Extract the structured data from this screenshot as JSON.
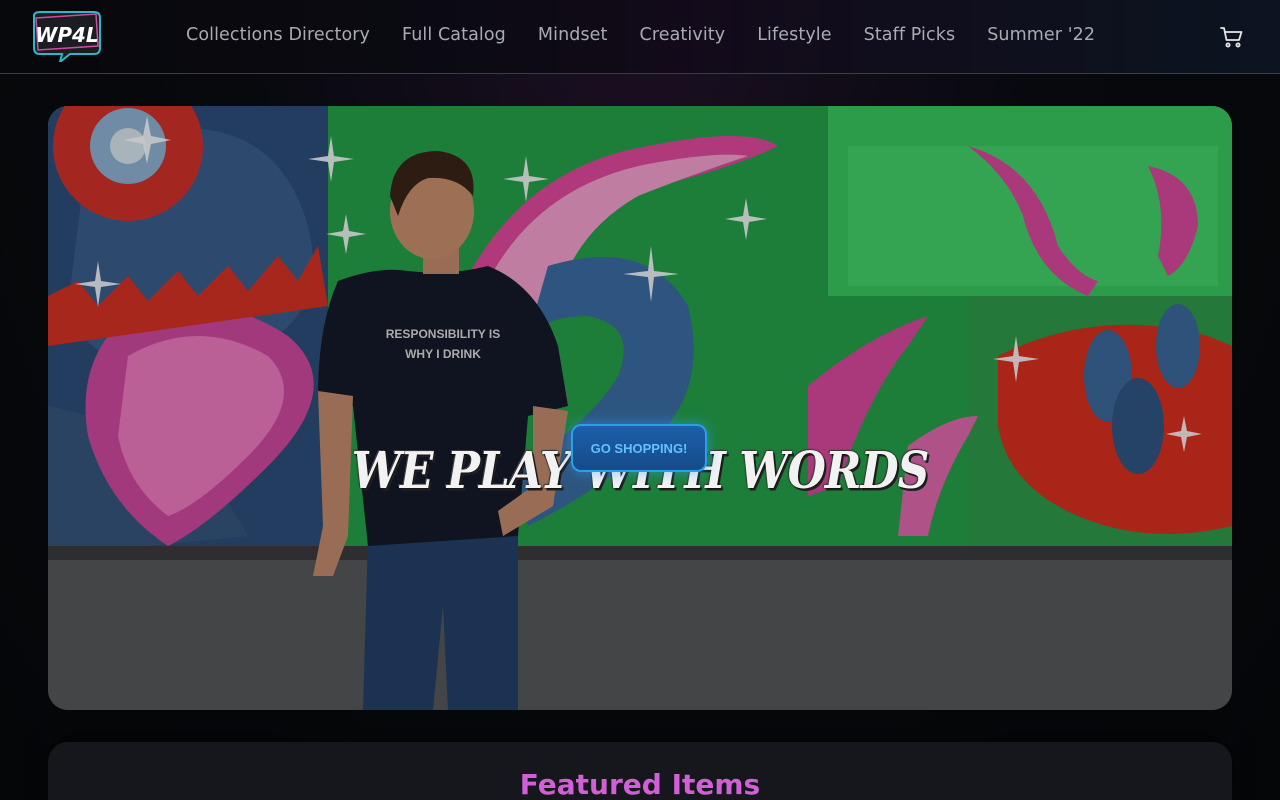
{
  "brand": {
    "logo_text": "WP4L"
  },
  "nav": {
    "items": [
      {
        "label": "Collections Directory"
      },
      {
        "label": "Full Catalog"
      },
      {
        "label": "Mindset"
      },
      {
        "label": "Creativity"
      },
      {
        "label": "Lifestyle"
      },
      {
        "label": "Staff Picks"
      },
      {
        "label": "Summer '22"
      }
    ],
    "cart_icon": "cart-icon"
  },
  "hero": {
    "title": "WE PLAY WITH WORDS",
    "button_label": "GO SHOPPING!",
    "shirt_text": "RESPONSIBILITY IS\nWHY I DRINK"
  },
  "featured": {
    "title": "Featured Items"
  },
  "colors": {
    "accent_pink": "#d160d6",
    "button_blue": "#1c5fa8",
    "button_glow": "#2aa0e6",
    "header_bg": "#07080b"
  }
}
